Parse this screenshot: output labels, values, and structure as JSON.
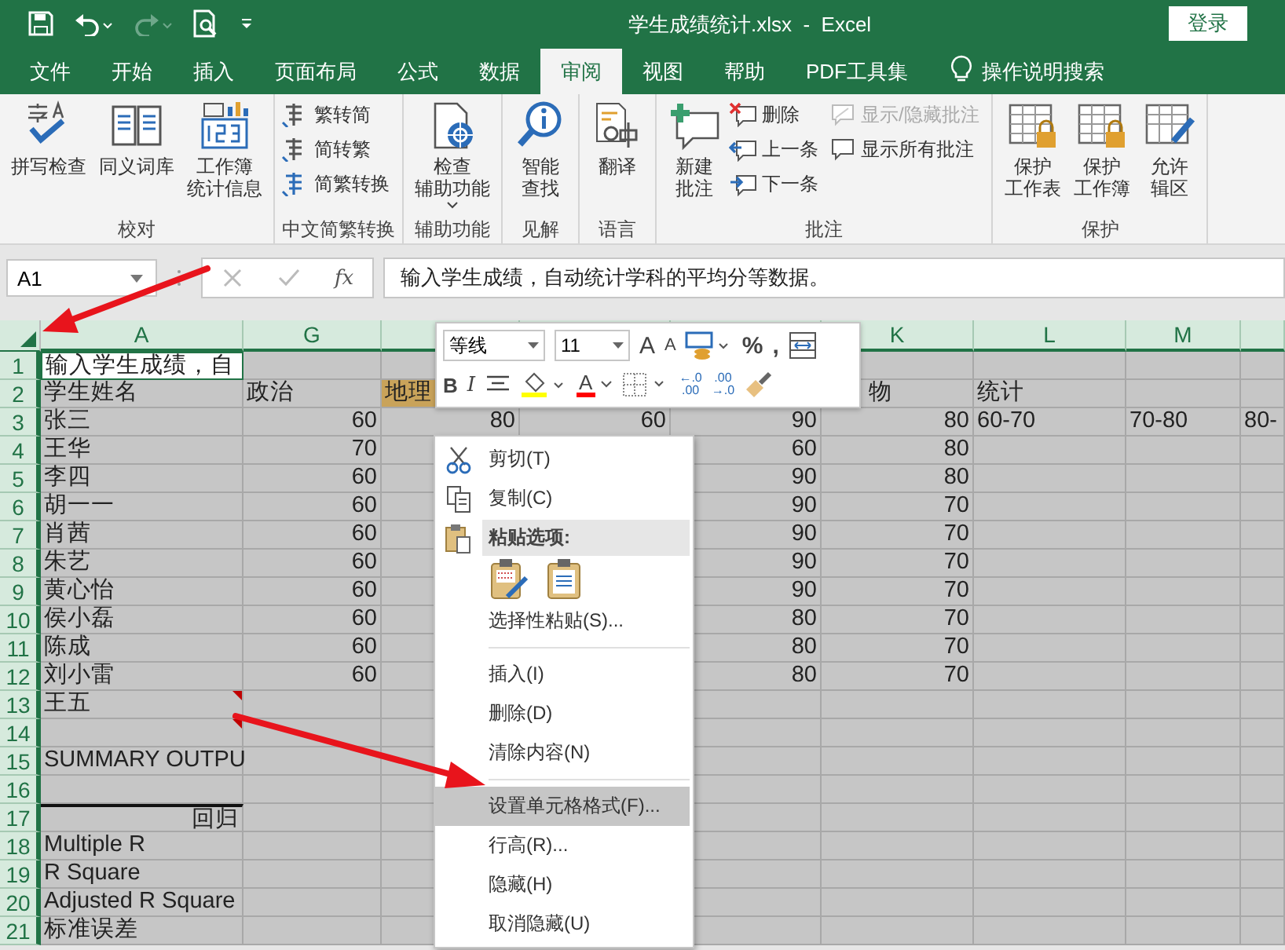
{
  "window": {
    "title": "学生成绩统计.xlsx  -  Excel",
    "login_button": "登录"
  },
  "tabs": [
    {
      "label": "文件",
      "selected": false
    },
    {
      "label": "开始",
      "selected": false
    },
    {
      "label": "插入",
      "selected": false
    },
    {
      "label": "页面布局",
      "selected": false
    },
    {
      "label": "公式",
      "selected": false
    },
    {
      "label": "数据",
      "selected": false
    },
    {
      "label": "审阅",
      "selected": true
    },
    {
      "label": "视图",
      "selected": false
    },
    {
      "label": "帮助",
      "selected": false
    },
    {
      "label": "PDF工具集",
      "selected": false
    }
  ],
  "tell_me": {
    "label": "操作说明搜索"
  },
  "ribbon": {
    "groups": [
      {
        "label": "校对",
        "columns": [
          [
            {
              "kind": "large",
              "lines": [
                "拼写检查"
              ]
            }
          ],
          [
            {
              "kind": "large",
              "lines": [
                "同义词库"
              ]
            }
          ],
          [
            {
              "kind": "large",
              "lines": [
                "工作簿",
                "统计信息"
              ]
            }
          ]
        ]
      },
      {
        "label": "中文简繁转换",
        "columns": [
          [
            {
              "kind": "small",
              "lines": [
                "繁转简"
              ]
            },
            {
              "kind": "small",
              "lines": [
                "简转繁"
              ]
            },
            {
              "kind": "small",
              "lines": [
                "简繁转换"
              ]
            }
          ]
        ]
      },
      {
        "label": "辅助功能",
        "columns": [
          [
            {
              "kind": "large",
              "lines": [
                "检查",
                "辅助功能"
              ],
              "dropdown": true
            }
          ]
        ]
      },
      {
        "label": "见解",
        "columns": [
          [
            {
              "kind": "large",
              "lines": [
                "智能",
                "查找"
              ]
            }
          ]
        ]
      },
      {
        "label": "语言",
        "columns": [
          [
            {
              "kind": "large",
              "lines": [
                "翻译"
              ]
            }
          ]
        ]
      },
      {
        "label": "批注",
        "columns": [
          [
            {
              "kind": "large",
              "lines": [
                "新建",
                "批注"
              ]
            }
          ],
          [
            {
              "kind": "small",
              "lines": [
                "删除"
              ]
            },
            {
              "kind": "small",
              "lines": [
                "上一条"
              ]
            },
            {
              "kind": "small",
              "lines": [
                "下一条"
              ]
            }
          ],
          [
            {
              "kind": "small",
              "lines": [
                "显示/隐藏批注"
              ],
              "disabled": true
            },
            {
              "kind": "small",
              "lines": [
                "显示所有批注"
              ],
              "disabled": false
            }
          ]
        ]
      },
      {
        "label": "保护",
        "columns": [
          [
            {
              "kind": "large",
              "lines": [
                "保护",
                "工作表"
              ]
            }
          ],
          [
            {
              "kind": "large",
              "lines": [
                "保护",
                "工作簿"
              ]
            }
          ],
          [
            {
              "kind": "large",
              "lines": [
                "允许",
                "辑区"
              ]
            }
          ]
        ]
      }
    ]
  },
  "formula_bar": {
    "name_box": "A1",
    "function_glyph": "fx",
    "formula": "输入学生成绩，自动统计学科的平均分等数据。"
  },
  "sheet": {
    "columns": [
      {
        "header": "A"
      },
      {
        "header": "G"
      },
      {},
      {},
      {},
      {
        "header": "K"
      },
      {
        "header": "L"
      },
      {
        "header": "M"
      },
      {}
    ],
    "rows": [
      {
        "number": "1",
        "kind": "data",
        "cells": [
          {
            "text": "输入学生成绩，自",
            "active": true
          }
        ]
      },
      {
        "number": "2",
        "kind": "header",
        "cells": [
          "学生姓名",
          "政治",
          {
            "text": "地理",
            "highlighted": true
          },
          null,
          null,
          {
            "text": "物",
            "covered": true
          },
          "统计"
        ]
      },
      {
        "number": "3",
        "kind": "data",
        "cells": [
          "张三",
          "60",
          "80",
          "60",
          "90",
          "80",
          "60-70",
          "70-80",
          "80-"
        ]
      },
      {
        "number": "4",
        "kind": "data",
        "cells": [
          "王华",
          "70",
          null,
          null,
          "60",
          "80"
        ]
      },
      {
        "number": "5",
        "kind": "data",
        "cells": [
          "李四",
          "60",
          null,
          null,
          "90",
          "80"
        ]
      },
      {
        "number": "6",
        "kind": "data",
        "cells": [
          "胡一一",
          "60",
          null,
          null,
          "90",
          "70"
        ]
      },
      {
        "number": "7",
        "kind": "data",
        "cells": [
          "肖茜",
          "60",
          null,
          null,
          "90",
          "70"
        ]
      },
      {
        "number": "8",
        "kind": "data",
        "cells": [
          "朱艺",
          "60",
          null,
          null,
          "90",
          "70"
        ]
      },
      {
        "number": "9",
        "kind": "data",
        "cells": [
          "黄心怡",
          "60",
          null,
          null,
          "90",
          "70"
        ]
      },
      {
        "number": "10",
        "kind": "data",
        "cells": [
          "侯小磊",
          "60",
          null,
          null,
          "80",
          "70"
        ]
      },
      {
        "number": "11",
        "kind": "data",
        "cells": [
          "陈成",
          "60",
          null,
          null,
          "80",
          "70"
        ]
      },
      {
        "number": "12",
        "kind": "data",
        "cells": [
          "刘小雷",
          "60",
          null,
          null,
          "80",
          "70"
        ]
      },
      {
        "number": "13",
        "kind": "data",
        "cells": [
          {
            "text": "王五",
            "comment": true
          }
        ]
      },
      {
        "number": "14",
        "kind": "data",
        "cells": [
          {
            "comment": true
          }
        ]
      },
      {
        "number": "15",
        "kind": "data",
        "cells": [
          "SUMMARY OUTPU"
        ]
      },
      {
        "number": "16",
        "kind": "data",
        "cells": []
      },
      {
        "number": "17",
        "kind": "data",
        "cells": [
          {
            "text": "回归",
            "kind": "table-title"
          }
        ]
      },
      {
        "number": "18",
        "kind": "data",
        "cells": [
          "Multiple R"
        ]
      },
      {
        "number": "19",
        "kind": "data",
        "cells": [
          "R Square"
        ]
      },
      {
        "number": "20",
        "kind": "data",
        "cells": [
          "Adjusted R Square"
        ]
      },
      {
        "number": "21",
        "kind": "data",
        "cells": [
          "标准误差"
        ]
      }
    ]
  },
  "mini_toolbar": {
    "font": "等线",
    "size": "11",
    "row1": [
      {
        "kind": "grow-font",
        "glyph": "A"
      },
      {
        "kind": "shrink-font",
        "glyph": "A"
      },
      {
        "kind": "accounting"
      },
      {
        "kind": "percent",
        "glyph": "%"
      },
      {
        "kind": "comma",
        "glyph": ","
      },
      {
        "kind": "wrap"
      }
    ],
    "row2": [
      {
        "kind": "bold",
        "glyph": "B"
      },
      {
        "kind": "italic",
        "glyph": "I"
      },
      {
        "kind": "center"
      },
      {
        "kind": "fill-color",
        "color": "#ffff00"
      },
      {
        "kind": "font-color",
        "glyph": "A",
        "color": "#ff0000"
      },
      {
        "kind": "borders"
      },
      {
        "kind": "increase-decimal",
        "lines": [
          "←.0",
          ".00"
        ]
      },
      {
        "kind": "decrease-decimal",
        "lines": [
          ".00",
          "→.0"
        ]
      },
      {
        "kind": "format-painter"
      }
    ]
  },
  "context_menu": {
    "items": [
      {
        "kind": "cut",
        "label": "剪切(T)",
        "selected": false
      },
      {
        "kind": "copy",
        "label": "复制(C)",
        "selected": false
      },
      {
        "kind": "paste-header",
        "label": "粘贴选项:",
        "selected": false
      },
      {
        "kind": "paste-options",
        "selected": false
      },
      {
        "kind": "plain",
        "label": "选择性粘贴(S)...",
        "selected": false
      },
      {
        "kind": "separator"
      },
      {
        "kind": "plain",
        "label": "插入(I)",
        "selected": false
      },
      {
        "kind": "plain",
        "label": "删除(D)",
        "selected": false
      },
      {
        "kind": "plain",
        "label": "清除内容(N)",
        "selected": false
      },
      {
        "kind": "separator"
      },
      {
        "kind": "format-cells",
        "label": "设置单元格格式(F)...",
        "selected": true
      },
      {
        "kind": "plain",
        "label": "行高(R)...",
        "selected": false
      },
      {
        "kind": "plain",
        "label": "隐藏(H)",
        "selected": false
      },
      {
        "kind": "plain",
        "label": "取消隐藏(U)",
        "selected": false
      }
    ]
  }
}
